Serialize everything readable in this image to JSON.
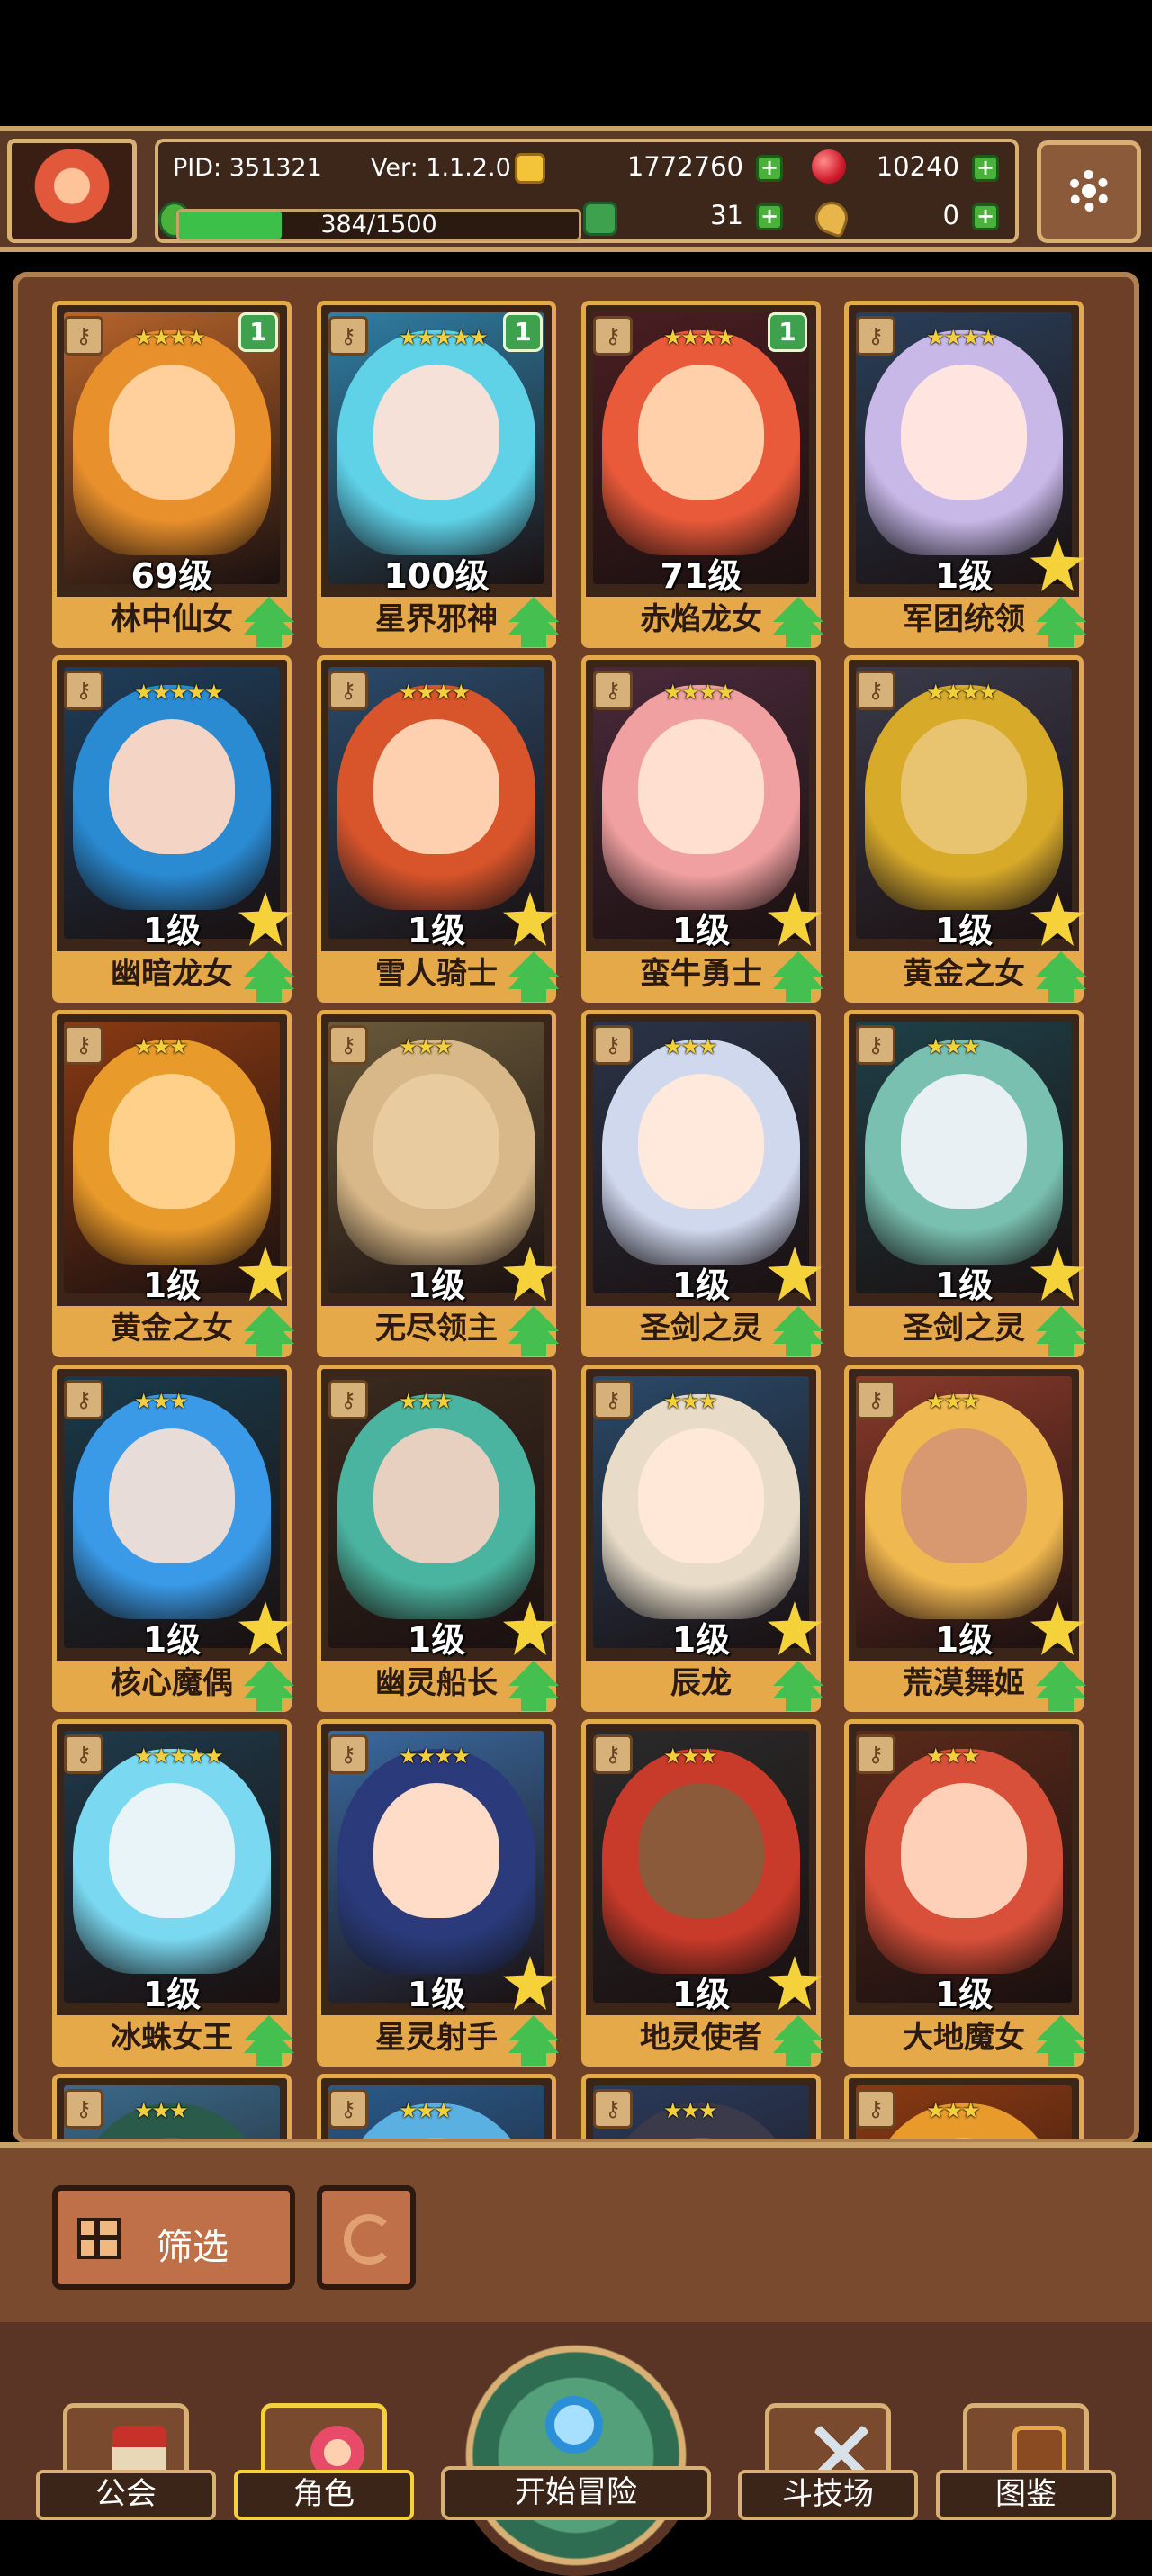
{
  "header": {
    "pid": "PID: 351321",
    "version": "Ver: 1.1.2.0",
    "gold": "1772760",
    "gems": "10240",
    "clover": "31",
    "keys": "0",
    "xp_text": "384/1500",
    "xp_progress": 0.256
  },
  "heroes": [
    {
      "name": "林中仙女",
      "level": "69级",
      "stars": "★★★★",
      "badge": "1",
      "max_star": false,
      "hair": "#e8902c",
      "skin": "#ffcf9c",
      "bg": "#b8642a"
    },
    {
      "name": "星界邪神",
      "level": "100级",
      "stars": "★★★★★",
      "badge": "1",
      "max_star": false,
      "hair": "#5fd2e8",
      "skin": "#f6e1d8",
      "bg": "#2f7fa6"
    },
    {
      "name": "赤焰龙女",
      "level": "71级",
      "stars": "★★★★",
      "badge": "1",
      "max_star": false,
      "hair": "#e85a3a",
      "skin": "#ffd0aa",
      "bg": "#4a1e22"
    },
    {
      "name": "军团统领",
      "level": "1级",
      "stars": "★★★★",
      "badge": "",
      "max_star": true,
      "hair": "#c8b8e8",
      "skin": "#ffe4e0",
      "bg": "#2a3f5a"
    },
    {
      "name": "幽暗龙女",
      "level": "1级",
      "stars": "★★★★★",
      "badge": "",
      "max_star": true,
      "hair": "#2a8ad2",
      "skin": "#f4d4c4",
      "bg": "#1e3e5a"
    },
    {
      "name": "雪人骑士",
      "level": "1级",
      "stars": "★★★★",
      "badge": "",
      "max_star": true,
      "hair": "#d8542a",
      "skin": "#ffd0b0",
      "bg": "#2a4a6a"
    },
    {
      "name": "蛮牛勇士",
      "level": "1级",
      "stars": "★★★★",
      "badge": "",
      "max_star": true,
      "hair": "#f0a0a0",
      "skin": "#ffe0d0",
      "bg": "#4a2a3a"
    },
    {
      "name": "黄金之女",
      "level": "1级",
      "stars": "★★★★",
      "badge": "",
      "max_star": true,
      "hair": "#d8aa2a",
      "skin": "#e8c470",
      "bg": "#3a3a4a"
    },
    {
      "name": "黄金之女",
      "level": "1级",
      "stars": "★★★",
      "badge": "",
      "max_star": true,
      "hair": "#e89a2a",
      "skin": "#ffd08a",
      "bg": "#8a3a12"
    },
    {
      "name": "无尽领主",
      "level": "1级",
      "stars": "★★★",
      "badge": "",
      "max_star": true,
      "hair": "#d8b888",
      "skin": "#e8cca0",
      "bg": "#6a5a3a"
    },
    {
      "name": "圣剑之灵",
      "level": "1级",
      "stars": "★★★",
      "badge": "",
      "max_star": true,
      "hair": "#d0d8ee",
      "skin": "#ffe8dc",
      "bg": "#2a3448"
    },
    {
      "name": "圣剑之灵",
      "level": "1级",
      "stars": "★★★",
      "badge": "",
      "max_star": true,
      "hair": "#7ac0b0",
      "skin": "#e8f0f4",
      "bg": "#1e4048"
    },
    {
      "name": "核心魔偶",
      "level": "1级",
      "stars": "★★★",
      "badge": "",
      "max_star": true,
      "hair": "#3a9ae8",
      "skin": "#e8dcd8",
      "bg": "#1a3a4a"
    },
    {
      "name": "幽灵船长",
      "level": "1级",
      "stars": "★★★",
      "badge": "",
      "max_star": true,
      "hair": "#4ab4a0",
      "skin": "#e8d0c0",
      "bg": "#3a2a1e"
    },
    {
      "name": "辰龙",
      "level": "1级",
      "stars": "★★★",
      "badge": "",
      "max_star": true,
      "hair": "#e8dcc8",
      "skin": "#ffe8d8",
      "bg": "#2a4a6a"
    },
    {
      "name": "荒漠舞姬",
      "level": "1级",
      "stars": "★★★",
      "badge": "",
      "max_star": true,
      "hair": "#f0b850",
      "skin": "#d89870",
      "bg": "#8a3a2a"
    },
    {
      "name": "冰蛛女王",
      "level": "1级",
      "stars": "★★★★★",
      "badge": "",
      "max_star": false,
      "hair": "#7ad8f0",
      "skin": "#e8f4f8",
      "bg": "#1e3a4a"
    },
    {
      "name": "星灵射手",
      "level": "1级",
      "stars": "★★★★",
      "badge": "",
      "max_star": true,
      "hair": "#2a3a7a",
      "skin": "#ffdcc8",
      "bg": "#3a6aa0"
    },
    {
      "name": "地灵使者",
      "level": "1级",
      "stars": "★★★",
      "badge": "",
      "max_star": true,
      "hair": "#c83a2a",
      "skin": "#8a5a3a",
      "bg": "#2a2a2a"
    },
    {
      "name": "大地魔女",
      "level": "1级",
      "stars": "★★★",
      "badge": "",
      "max_star": false,
      "hair": "#d8503a",
      "skin": "#ffd0b8",
      "bg": "#5a2a1a"
    },
    {
      "name": "",
      "level": "",
      "stars": "★★★",
      "badge": "",
      "max_star": false,
      "hair": "#2a5a4a",
      "skin": "#3a6a5a",
      "bg": "#3a6a8a"
    },
    {
      "name": "",
      "level": "",
      "stars": "★★★",
      "badge": "",
      "max_star": false,
      "hair": "#5ab0e0",
      "skin": "#7ac0e8",
      "bg": "#2a5a8a"
    },
    {
      "name": "",
      "level": "",
      "stars": "★★★",
      "badge": "",
      "max_star": false,
      "hair": "#3a3a4a",
      "skin": "#5a5a6a",
      "bg": "#2a3a5a"
    },
    {
      "name": "",
      "level": "",
      "stars": "★★★",
      "badge": "",
      "max_star": false,
      "hair": "#e89a2a",
      "skin": "#f0b860",
      "bg": "#8a3a12"
    }
  ],
  "toolbar": {
    "filter_label": "筛选"
  },
  "nav": {
    "guild": "公会",
    "character": "角色",
    "adventure": "开始冒险",
    "arena": "斗技场",
    "codex": "图鉴"
  }
}
